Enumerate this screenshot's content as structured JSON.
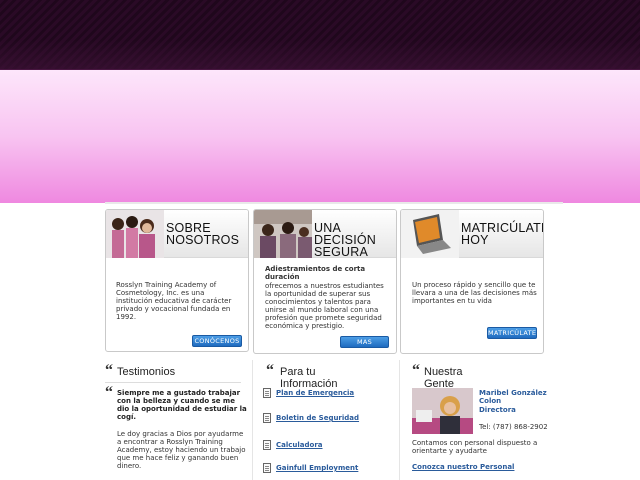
{
  "cards": [
    {
      "title_line1": "SOBRE",
      "title_line2": "NOSOTROS",
      "body": "Rosslyn Training Academy of Cosmetology, Inc. es una institución educativa de carácter privado y vocacional fundada en 1992.",
      "button": "CONÓCENOS"
    },
    {
      "title_line1": "UNA DECISIÓN",
      "title_line2": "SEGURA",
      "subtitle": "Adiestramientos de corta duración",
      "body": "ofrecemos a nuestros estudiantes la oportunidad de superar sus conocimientos y talentos para unirse al mundo laboral con una profesión que promete seguridad económica y prestigio.",
      "button": "MAS"
    },
    {
      "title_line1": "MATRICÚLATE",
      "title_line2": "HOY",
      "body": "Un proceso rápido y sencillo que te llevara a una de las decisiones más importantes en tu vida",
      "button": "MATRICÚLATE"
    }
  ],
  "testimonios": {
    "title": "Testimonios",
    "quote": "Siempre me a gustado trabajar con la belleza y cuando se me dio la oportunidad de estudiar la cogí.",
    "text": "Le doy gracias a Dios por ayudarme a encontrar a Rosslyn Training Academy, estoy haciendo un trabajo que me hace feliz y ganando buen dinero."
  },
  "info": {
    "title": "Para tu Información",
    "links": [
      "Plan de Emergencia",
      "Boletin de Seguridad",
      "Calculadora",
      "Gainfull Employment"
    ]
  },
  "gente": {
    "title": "Nuestra Gente",
    "name": "Maribel González Colon",
    "role": "Directora",
    "phone": "Tel: (787) 868-2902",
    "contact": "Contamos con personal dispuesto a orientarte y ayudarte",
    "link": "Conozca nuestro Personal"
  },
  "colors": {
    "link": "#2a5b9b",
    "button": "#1f6bbf",
    "hero_pink": "#ef88e0"
  }
}
